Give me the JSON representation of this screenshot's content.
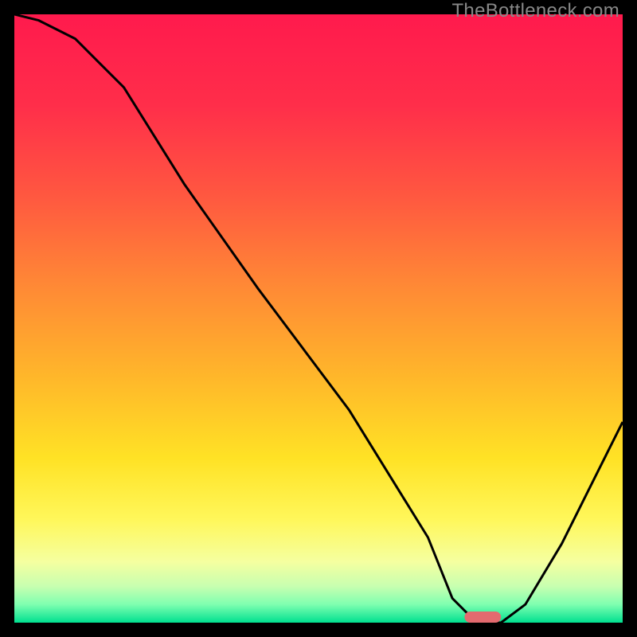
{
  "watermark": "TheBottleneck.com",
  "accent_marker_color": "#e36a6f",
  "chart_data": {
    "type": "line",
    "title": "",
    "xlabel": "",
    "ylabel": "",
    "xlim": [
      0,
      100
    ],
    "ylim": [
      0,
      100
    ],
    "x": [
      0,
      4,
      10,
      18,
      23,
      28,
      40,
      55,
      68,
      72,
      76,
      80,
      84,
      90,
      96,
      100
    ],
    "values": [
      100,
      99,
      96,
      88,
      80,
      72,
      55,
      35,
      14,
      4,
      0,
      0,
      3,
      13,
      25,
      33
    ],
    "gradient_stops": [
      {
        "offset": 0.0,
        "color": "#ff1a4d"
      },
      {
        "offset": 0.15,
        "color": "#ff2e4a"
      },
      {
        "offset": 0.3,
        "color": "#ff5840"
      },
      {
        "offset": 0.45,
        "color": "#ff8a35"
      },
      {
        "offset": 0.6,
        "color": "#ffb82a"
      },
      {
        "offset": 0.73,
        "color": "#ffe225"
      },
      {
        "offset": 0.83,
        "color": "#fff75a"
      },
      {
        "offset": 0.9,
        "color": "#f5ffa0"
      },
      {
        "offset": 0.94,
        "color": "#c8ffb0"
      },
      {
        "offset": 0.97,
        "color": "#7fffb0"
      },
      {
        "offset": 1.0,
        "color": "#00e090"
      }
    ],
    "marker": {
      "x_center": 77,
      "width": 6
    }
  }
}
